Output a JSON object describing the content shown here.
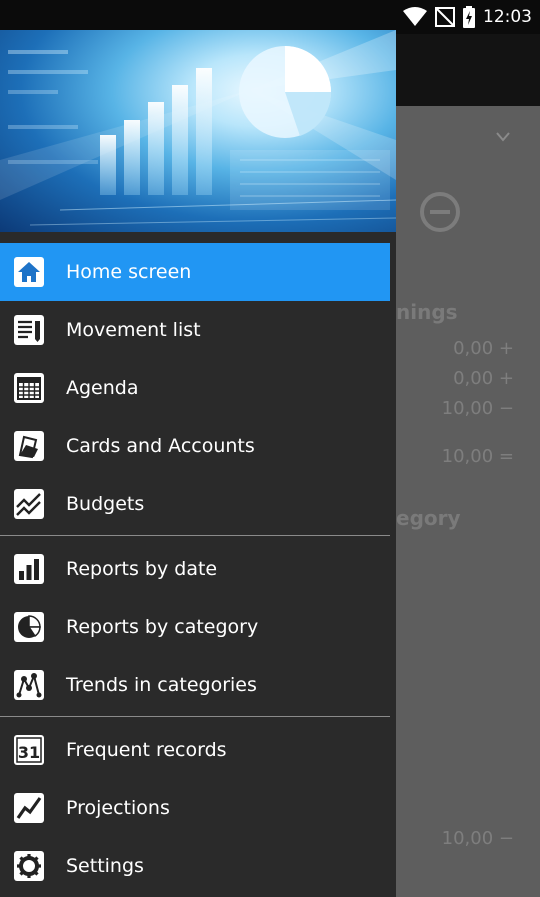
{
  "status_bar": {
    "time": "12:03",
    "icons": [
      "wifi-icon",
      "no-signal-icon",
      "battery-icon"
    ]
  },
  "background": {
    "heading_1": "nings",
    "heading_2": "egory",
    "values": [
      "0,00 +",
      "0,00 +",
      "10,00 −",
      "10,00 =",
      "10,00 −"
    ]
  },
  "drawer": {
    "items": [
      {
        "label": "Home screen",
        "icon": "home-icon",
        "active": true
      },
      {
        "label": "Movement list",
        "icon": "list-icon"
      },
      {
        "label": "Agenda",
        "icon": "calendar-icon"
      },
      {
        "label": "Cards and Accounts",
        "icon": "cards-icon"
      },
      {
        "label": "Budgets",
        "icon": "budget-chart-icon"
      },
      {
        "label": "Reports by date",
        "icon": "bar-chart-icon"
      },
      {
        "label": "Reports by category",
        "icon": "pie-chart-icon"
      },
      {
        "label": "Trends in categories",
        "icon": "trends-icon"
      },
      {
        "label": "Frequent records",
        "icon": "calendar-31-icon"
      },
      {
        "label": "Projections",
        "icon": "projection-icon"
      },
      {
        "label": "Settings",
        "icon": "settings-icon"
      }
    ]
  },
  "colors": {
    "active_item": "#2196f3",
    "drawer_bg": "#2a2a2a",
    "icon_bg": "#ffffff"
  }
}
